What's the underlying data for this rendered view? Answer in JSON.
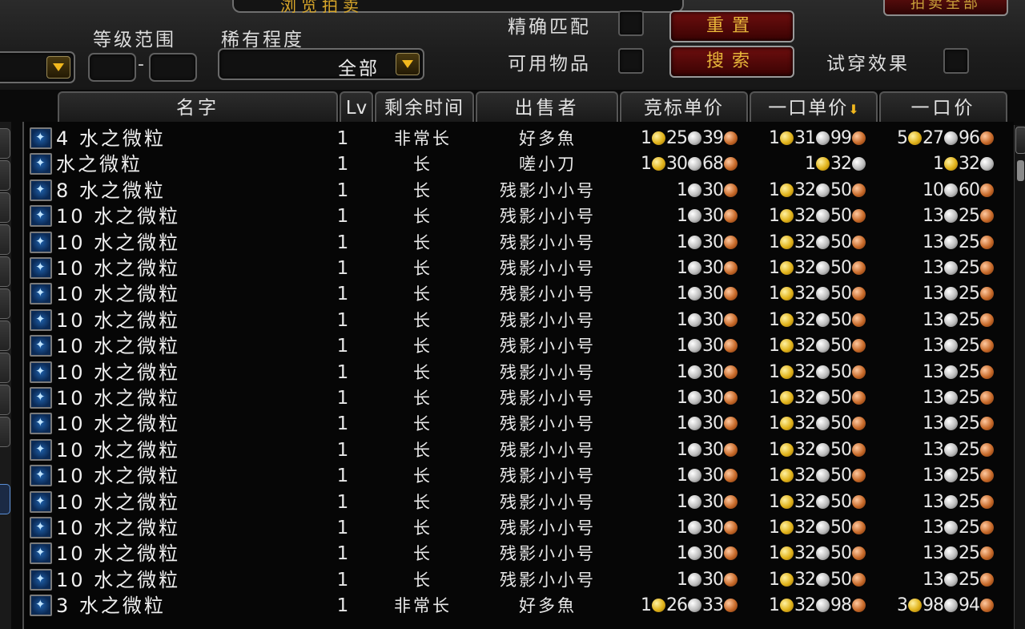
{
  "top": {
    "title": "浏览拍卖",
    "corner_button": "拍卖全部",
    "level_range_label": "等级范围",
    "rarity_label": "稀有程度",
    "rarity_value": "全部",
    "range_dash": "-",
    "exact_match_label": "精确匹配",
    "usable_items_label": "可用物品",
    "try_on_label": "试穿效果",
    "reset_button": "重置",
    "search_button": "搜索"
  },
  "columns": {
    "name": "名字",
    "lv": "Lv",
    "time_left": "剩余时间",
    "seller": "出售者",
    "bid_unit": "竞标单价",
    "buyout_unit": "一口单价",
    "buyout": "一口价"
  },
  "rows": [
    {
      "name": "4 水之微粒",
      "lv": "1",
      "time": "非常长",
      "seller": "好多魚",
      "bid": [
        1,
        25,
        39
      ],
      "buyout_unit": [
        1,
        31,
        99
      ],
      "buyout": [
        5,
        27,
        96
      ]
    },
    {
      "name": "水之微粒",
      "lv": "1",
      "time": "长",
      "seller": "嗟小刀",
      "bid": [
        1,
        30,
        68
      ],
      "buyout_unit": [
        1,
        32,
        null
      ],
      "buyout": [
        1,
        32,
        null
      ]
    },
    {
      "name": "8 水之微粒",
      "lv": "1",
      "time": "长",
      "seller": "残影小小号",
      "bid": [
        null,
        1,
        30
      ],
      "buyout_unit": [
        1,
        32,
        50
      ],
      "buyout": [
        null,
        10,
        60
      ]
    },
    {
      "name": "10 水之微粒",
      "lv": "1",
      "time": "长",
      "seller": "残影小小号",
      "bid": [
        null,
        1,
        30
      ],
      "buyout_unit": [
        1,
        32,
        50
      ],
      "buyout": [
        null,
        13,
        25
      ]
    },
    {
      "name": "10 水之微粒",
      "lv": "1",
      "time": "长",
      "seller": "残影小小号",
      "bid": [
        null,
        1,
        30
      ],
      "buyout_unit": [
        1,
        32,
        50
      ],
      "buyout": [
        null,
        13,
        25
      ]
    },
    {
      "name": "10 水之微粒",
      "lv": "1",
      "time": "长",
      "seller": "残影小小号",
      "bid": [
        null,
        1,
        30
      ],
      "buyout_unit": [
        1,
        32,
        50
      ],
      "buyout": [
        null,
        13,
        25
      ]
    },
    {
      "name": "10 水之微粒",
      "lv": "1",
      "time": "长",
      "seller": "残影小小号",
      "bid": [
        null,
        1,
        30
      ],
      "buyout_unit": [
        1,
        32,
        50
      ],
      "buyout": [
        null,
        13,
        25
      ]
    },
    {
      "name": "10 水之微粒",
      "lv": "1",
      "time": "长",
      "seller": "残影小小号",
      "bid": [
        null,
        1,
        30
      ],
      "buyout_unit": [
        1,
        32,
        50
      ],
      "buyout": [
        null,
        13,
        25
      ]
    },
    {
      "name": "10 水之微粒",
      "lv": "1",
      "time": "长",
      "seller": "残影小小号",
      "bid": [
        null,
        1,
        30
      ],
      "buyout_unit": [
        1,
        32,
        50
      ],
      "buyout": [
        null,
        13,
        25
      ]
    },
    {
      "name": "10 水之微粒",
      "lv": "1",
      "time": "长",
      "seller": "残影小小号",
      "bid": [
        null,
        1,
        30
      ],
      "buyout_unit": [
        1,
        32,
        50
      ],
      "buyout": [
        null,
        13,
        25
      ]
    },
    {
      "name": "10 水之微粒",
      "lv": "1",
      "time": "长",
      "seller": "残影小小号",
      "bid": [
        null,
        1,
        30
      ],
      "buyout_unit": [
        1,
        32,
        50
      ],
      "buyout": [
        null,
        13,
        25
      ]
    },
    {
      "name": "10 水之微粒",
      "lv": "1",
      "time": "长",
      "seller": "残影小小号",
      "bid": [
        null,
        1,
        30
      ],
      "buyout_unit": [
        1,
        32,
        50
      ],
      "buyout": [
        null,
        13,
        25
      ]
    },
    {
      "name": "10 水之微粒",
      "lv": "1",
      "time": "长",
      "seller": "残影小小号",
      "bid": [
        null,
        1,
        30
      ],
      "buyout_unit": [
        1,
        32,
        50
      ],
      "buyout": [
        null,
        13,
        25
      ]
    },
    {
      "name": "10 水之微粒",
      "lv": "1",
      "time": "长",
      "seller": "残影小小号",
      "bid": [
        null,
        1,
        30
      ],
      "buyout_unit": [
        1,
        32,
        50
      ],
      "buyout": [
        null,
        13,
        25
      ]
    },
    {
      "name": "10 水之微粒",
      "lv": "1",
      "time": "长",
      "seller": "残影小小号",
      "bid": [
        null,
        1,
        30
      ],
      "buyout_unit": [
        1,
        32,
        50
      ],
      "buyout": [
        null,
        13,
        25
      ]
    },
    {
      "name": "10 水之微粒",
      "lv": "1",
      "time": "长",
      "seller": "残影小小号",
      "bid": [
        null,
        1,
        30
      ],
      "buyout_unit": [
        1,
        32,
        50
      ],
      "buyout": [
        null,
        13,
        25
      ]
    },
    {
      "name": "10 水之微粒",
      "lv": "1",
      "time": "长",
      "seller": "残影小小号",
      "bid": [
        null,
        1,
        30
      ],
      "buyout_unit": [
        1,
        32,
        50
      ],
      "buyout": [
        null,
        13,
        25
      ]
    },
    {
      "name": "10 水之微粒",
      "lv": "1",
      "time": "长",
      "seller": "残影小小号",
      "bid": [
        null,
        1,
        30
      ],
      "buyout_unit": [
        1,
        32,
        50
      ],
      "buyout": [
        null,
        13,
        25
      ]
    },
    {
      "name": "3 水之微粒",
      "lv": "1",
      "time": "非常长",
      "seller": "好多魚",
      "bid": [
        1,
        26,
        33
      ],
      "buyout_unit": [
        1,
        32,
        98
      ],
      "buyout": [
        3,
        98,
        94
      ]
    }
  ],
  "icons": {
    "item": "water-mote-icon",
    "gold": "gold-coin-icon",
    "silver": "silver-coin-icon",
    "copper": "copper-coin-icon"
  }
}
